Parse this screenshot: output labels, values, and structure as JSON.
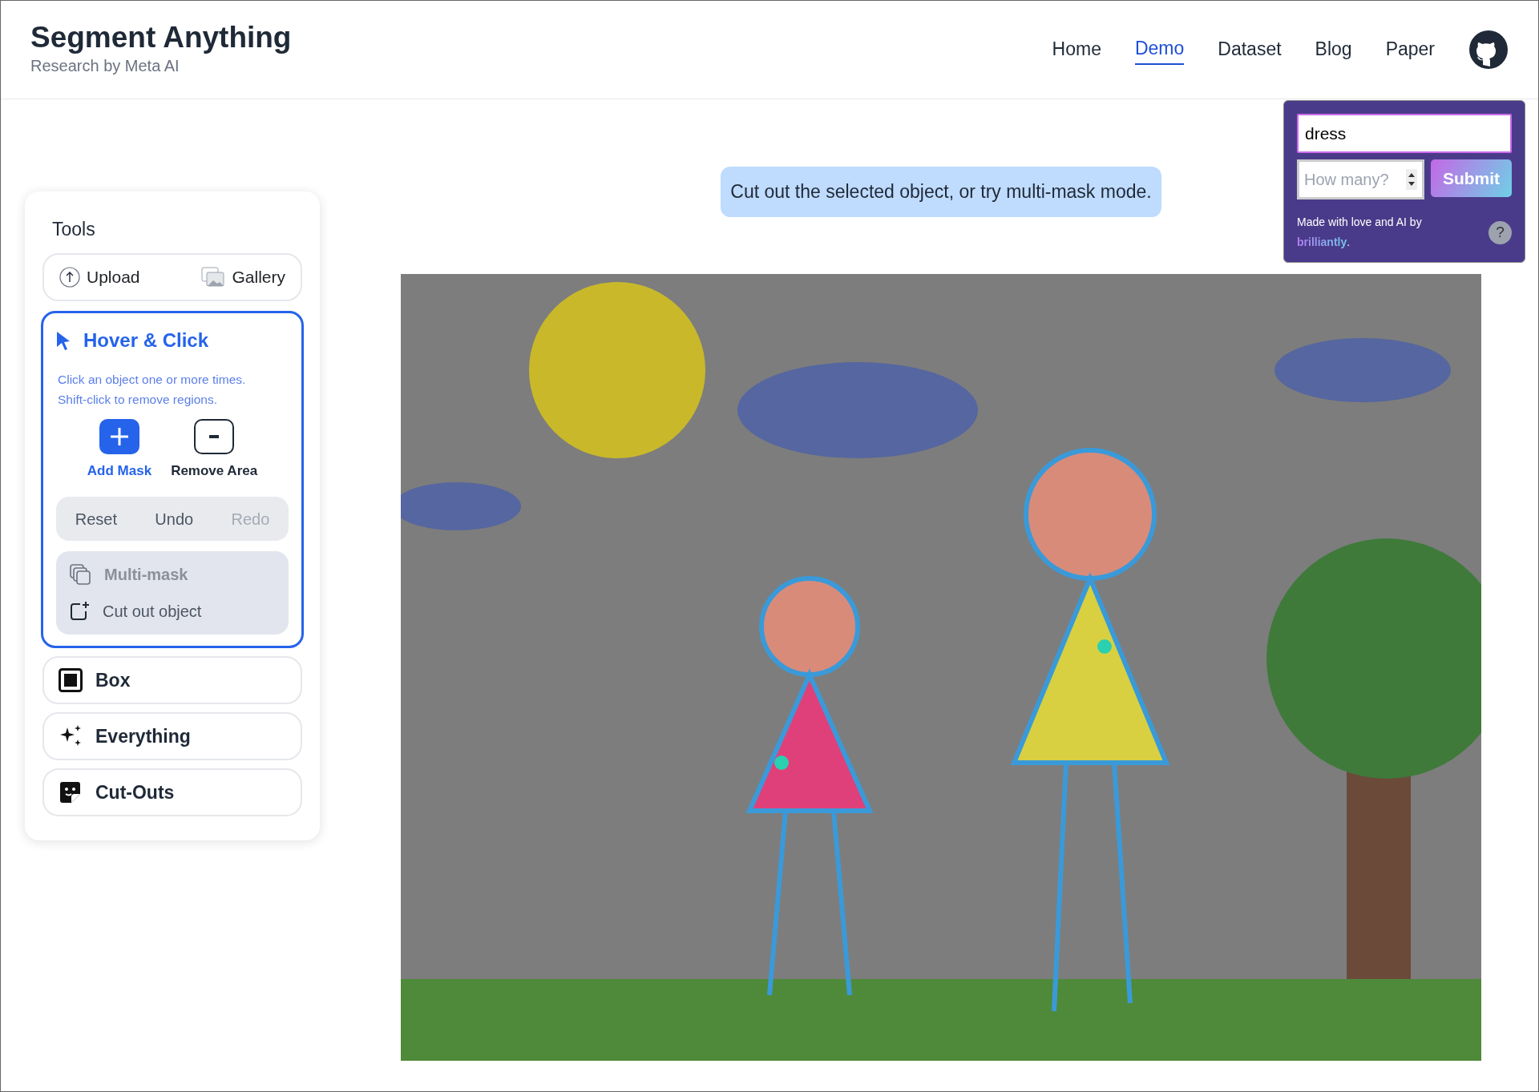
{
  "header": {
    "title": "Segment Anything",
    "subtitle": "Research by Meta AI",
    "nav": [
      {
        "label": "Home",
        "selected": false
      },
      {
        "label": "Demo",
        "selected": true
      },
      {
        "label": "Dataset",
        "selected": false
      },
      {
        "label": "Blog",
        "selected": false
      },
      {
        "label": "Paper",
        "selected": false
      }
    ]
  },
  "tools": {
    "heading": "Tools",
    "upload": "Upload",
    "gallery": "Gallery",
    "modes": [
      {
        "kind": "hover",
        "label": "Hover & Click",
        "selected": true,
        "description": [
          "Click an object one or more times.",
          "Shift-click to remove regions."
        ],
        "actions": [
          {
            "kind": "add",
            "label": "Add Mask",
            "selected": true
          },
          {
            "kind": "remove",
            "label": "Remove Area",
            "selected": false
          }
        ],
        "history": [
          {
            "label": "Reset",
            "disabled": false
          },
          {
            "label": "Undo",
            "disabled": false
          },
          {
            "label": "Redo",
            "disabled": true
          }
        ],
        "multimask": {
          "label": "Multi-mask",
          "disabled": true
        },
        "cutout": "Cut out object"
      },
      {
        "kind": "box",
        "label": "Box",
        "selected": false
      },
      {
        "kind": "everything",
        "label": "Everything",
        "selected": false
      },
      {
        "kind": "cutouts",
        "label": "Cut-Outs",
        "selected": false
      }
    ]
  },
  "banner": "Cut out the selected object, or try multi-mask mode.",
  "prompt_panel": {
    "query": "dress",
    "count_placeholder": "How many?",
    "submit": "Submit",
    "credit": {
      "text_before": "Made with love and AI by",
      "link": "brilliantly",
      "text_after": "."
    },
    "help": "?"
  }
}
